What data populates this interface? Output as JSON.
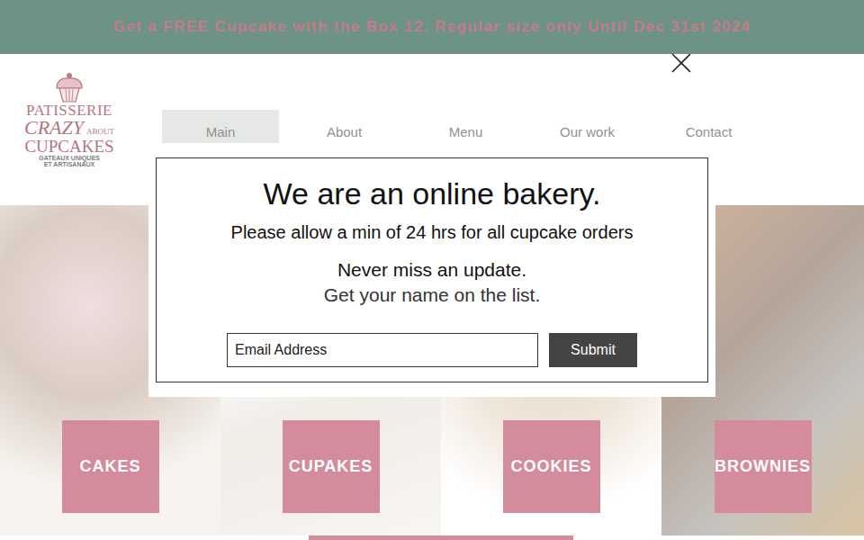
{
  "banner": {
    "text": "Get a FREE Cupcake with the Box 12. Regular size only Until Dec 31st 2024"
  },
  "logo": {
    "line1": "PATISSERIE",
    "line2": "CRAZY",
    "line3": "ABOUT",
    "line4": "CUPCAKES",
    "tagline1": "GATEAUX UNIQUES",
    "tagline2": "ET ARTISANAUX"
  },
  "nav": [
    {
      "label": "Main",
      "selected": true
    },
    {
      "label": "About",
      "selected": false
    },
    {
      "label": "Menu",
      "selected": false
    },
    {
      "label": "Our work",
      "selected": false
    },
    {
      "label": "Contact",
      "selected": false
    }
  ],
  "categories": [
    {
      "label": "CAKES"
    },
    {
      "label": "CUPAKES"
    },
    {
      "label": "COOKIES"
    },
    {
      "label": "BROWNIES"
    }
  ],
  "modal": {
    "title": "We are an online bakery.",
    "notice": "Please allow a min of 24 hrs for all cupcake orders",
    "subscribe_heading": "Never miss an update.",
    "subscribe_text": "Get your name on the list.",
    "email_placeholder": "Email Address",
    "submit": "Submit"
  }
}
